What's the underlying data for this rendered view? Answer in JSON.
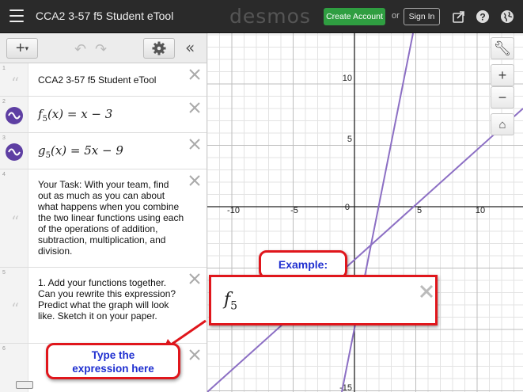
{
  "topbar": {
    "title": "CCA2 3-57 f5 Student eTool",
    "brand": "desmos",
    "create_account": "Create Account",
    "or": "or",
    "sign_in": "Sign In"
  },
  "expressions": [
    {
      "num": "1",
      "type": "text",
      "text": "CCA2 3-57 f5 Student eTool"
    },
    {
      "num": "2",
      "type": "math",
      "fn": "f",
      "sub": "5",
      "rest": "(x) = x − 3"
    },
    {
      "num": "3",
      "type": "math",
      "fn": "g",
      "sub": "5",
      "rest": "(x) = 5x − 9"
    },
    {
      "num": "4",
      "type": "text",
      "text": "Your Task: With your team, find out as much as you can about what happens when you combine the two linear functions using each of the operations of addition, subtraction, multiplication, and division."
    },
    {
      "num": "5",
      "type": "text",
      "text": "1. Add your functions together. Can you rewrite this expression? Predict what the graph will look like. Sketch it on your paper."
    },
    {
      "num": "6",
      "type": "text",
      "text": ""
    }
  ],
  "graph": {
    "x_ticks": [
      "-10",
      "-5",
      "0",
      "5",
      "10"
    ],
    "y_ticks_pos": [
      "10",
      "5"
    ],
    "y_ticks_neg": [
      "-15"
    ],
    "line_color": "#8c6fc4"
  },
  "callouts": {
    "example": "Example:",
    "type_here_line1": "Type the",
    "type_here_line2": "expression here",
    "example_fn": "f",
    "example_sub": "5"
  },
  "colors": {
    "accent": "#e0161c",
    "callout_text": "#1f2fd0",
    "create_btn": "#2f9e41"
  }
}
